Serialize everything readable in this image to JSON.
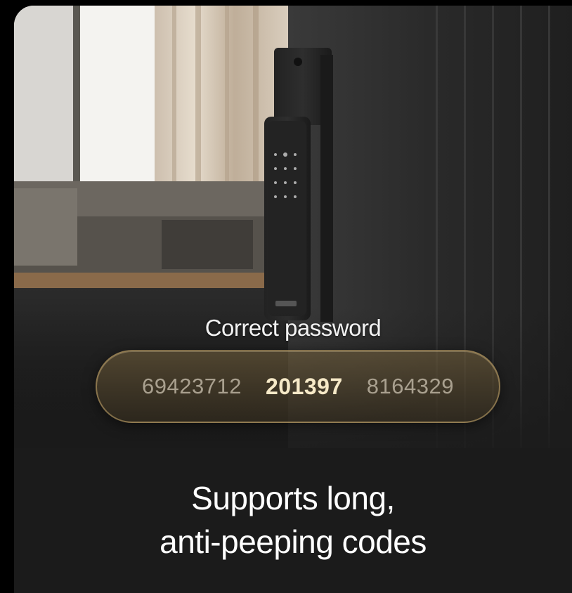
{
  "overlay": {
    "label": "Correct password",
    "codes": [
      "69423712",
      "201397",
      "8164329"
    ]
  },
  "caption": {
    "line1": "Supports long,",
    "line2": "anti-peeping codes"
  },
  "colors": {
    "accent_gold": "#c8aa6e",
    "highlight_code": "#f6e9c8",
    "background": "#1b1b1b"
  }
}
